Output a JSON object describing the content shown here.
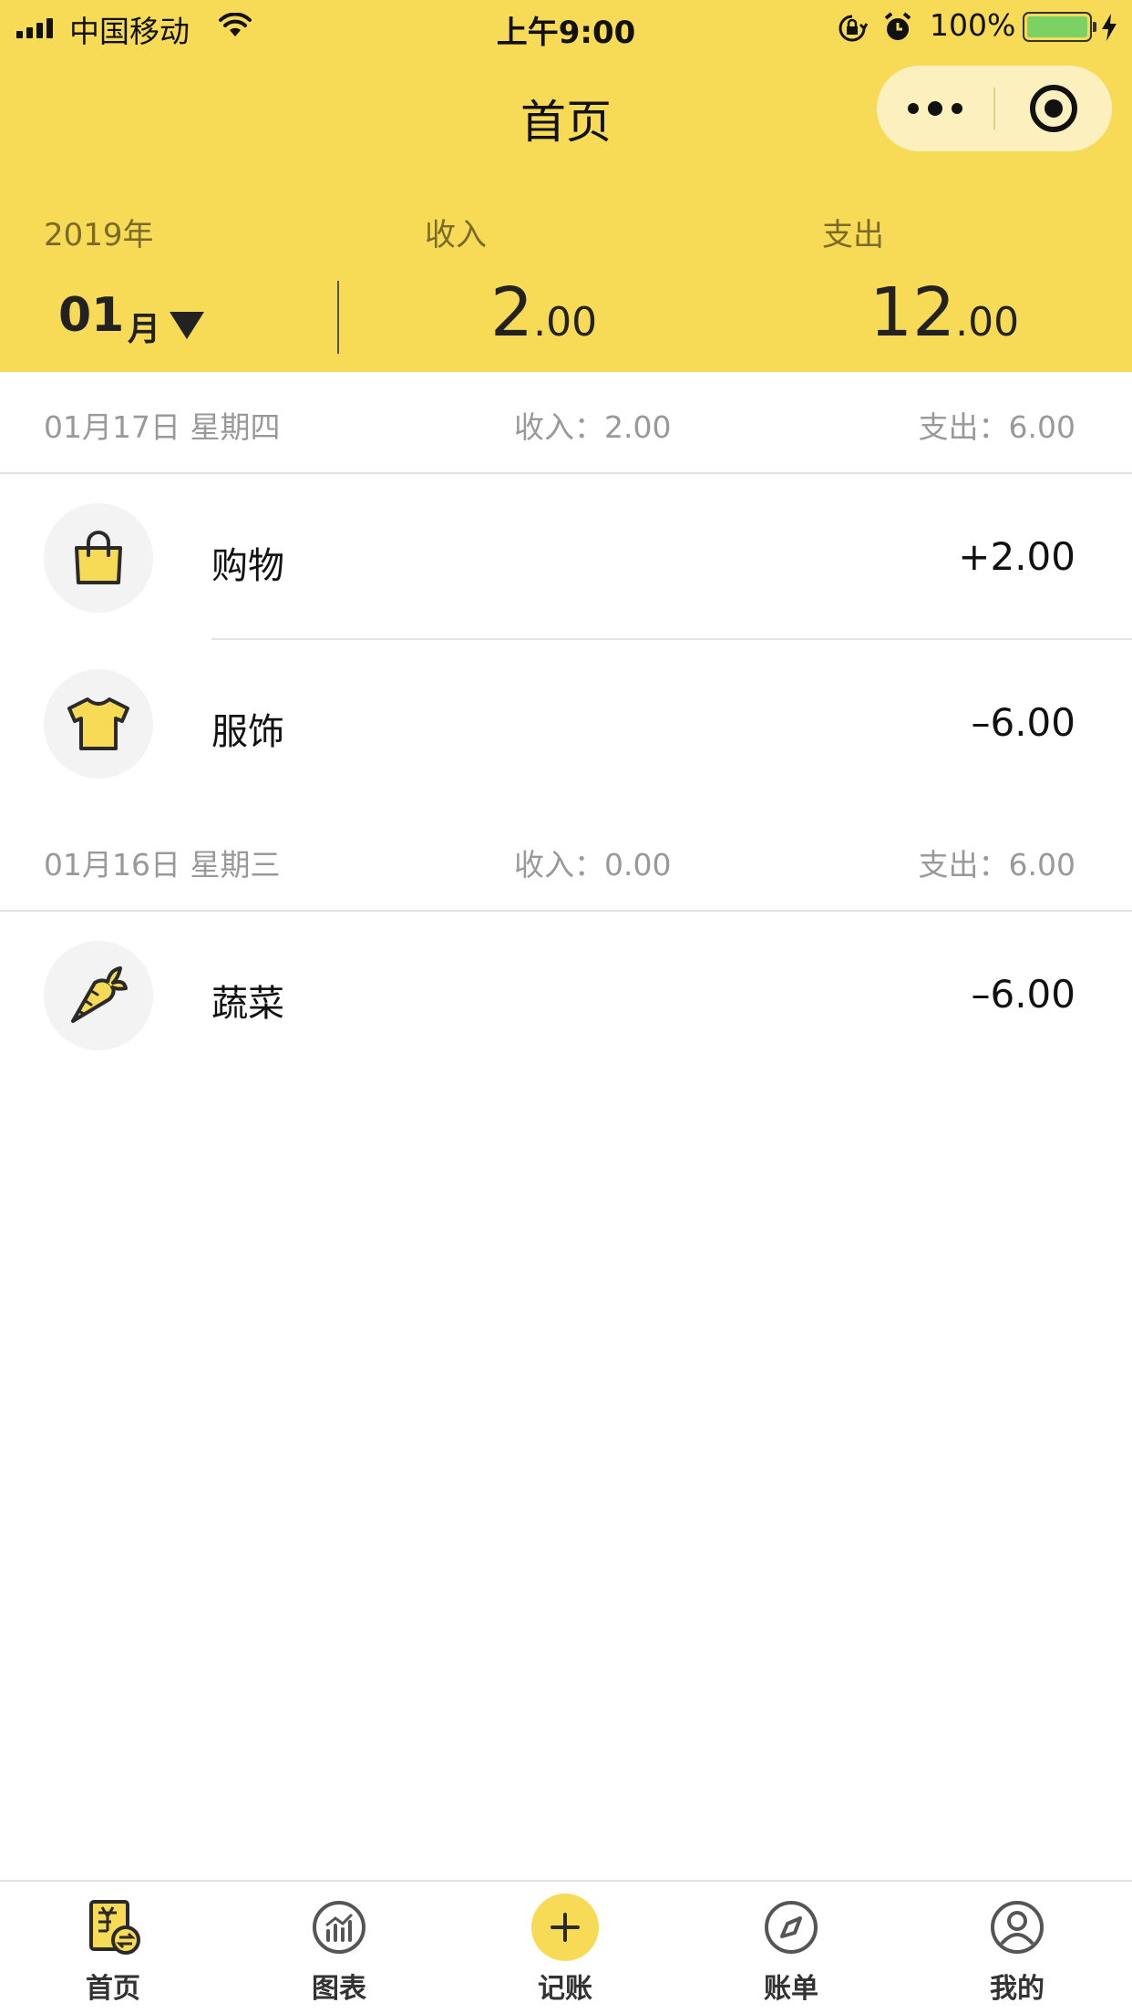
{
  "status_bar": {
    "carrier": "中国移动",
    "time": "上午9:00",
    "battery": "100%"
  },
  "nav": {
    "title": "首页"
  },
  "summary": {
    "year": "2019年",
    "month": "01",
    "month_unit": "月",
    "income_label": "收入",
    "expense_label": "支出",
    "income_int": "2",
    "income_dec": ".00",
    "expense_int": "12",
    "expense_dec": ".00"
  },
  "days": [
    {
      "date": "01月17日  星期四",
      "income": "收入：2.00",
      "expense": "支出：6.00",
      "records": [
        {
          "icon": "shopping-bag-icon",
          "name": "购物",
          "amount": "+2.00"
        },
        {
          "icon": "tshirt-icon",
          "name": "服饰",
          "amount": "–6.00"
        }
      ]
    },
    {
      "date": "01月16日  星期三",
      "income": "收入：0.00",
      "expense": "支出：6.00",
      "records": [
        {
          "icon": "carrot-icon",
          "name": "蔬菜",
          "amount": "–6.00"
        }
      ]
    }
  ],
  "tabs": [
    {
      "icon": "home-ledger-icon",
      "label": "首页"
    },
    {
      "icon": "chart-icon",
      "label": "图表"
    },
    {
      "icon": "plus-icon",
      "label": "记账"
    },
    {
      "icon": "compass-icon",
      "label": "账单"
    },
    {
      "icon": "user-icon",
      "label": "我的"
    }
  ],
  "colors": {
    "brand_yellow": "#F7DB57",
    "capsule": "#FCF1BE",
    "icon_bg": "#F3F3F3",
    "battery_green": "#7BD164"
  }
}
